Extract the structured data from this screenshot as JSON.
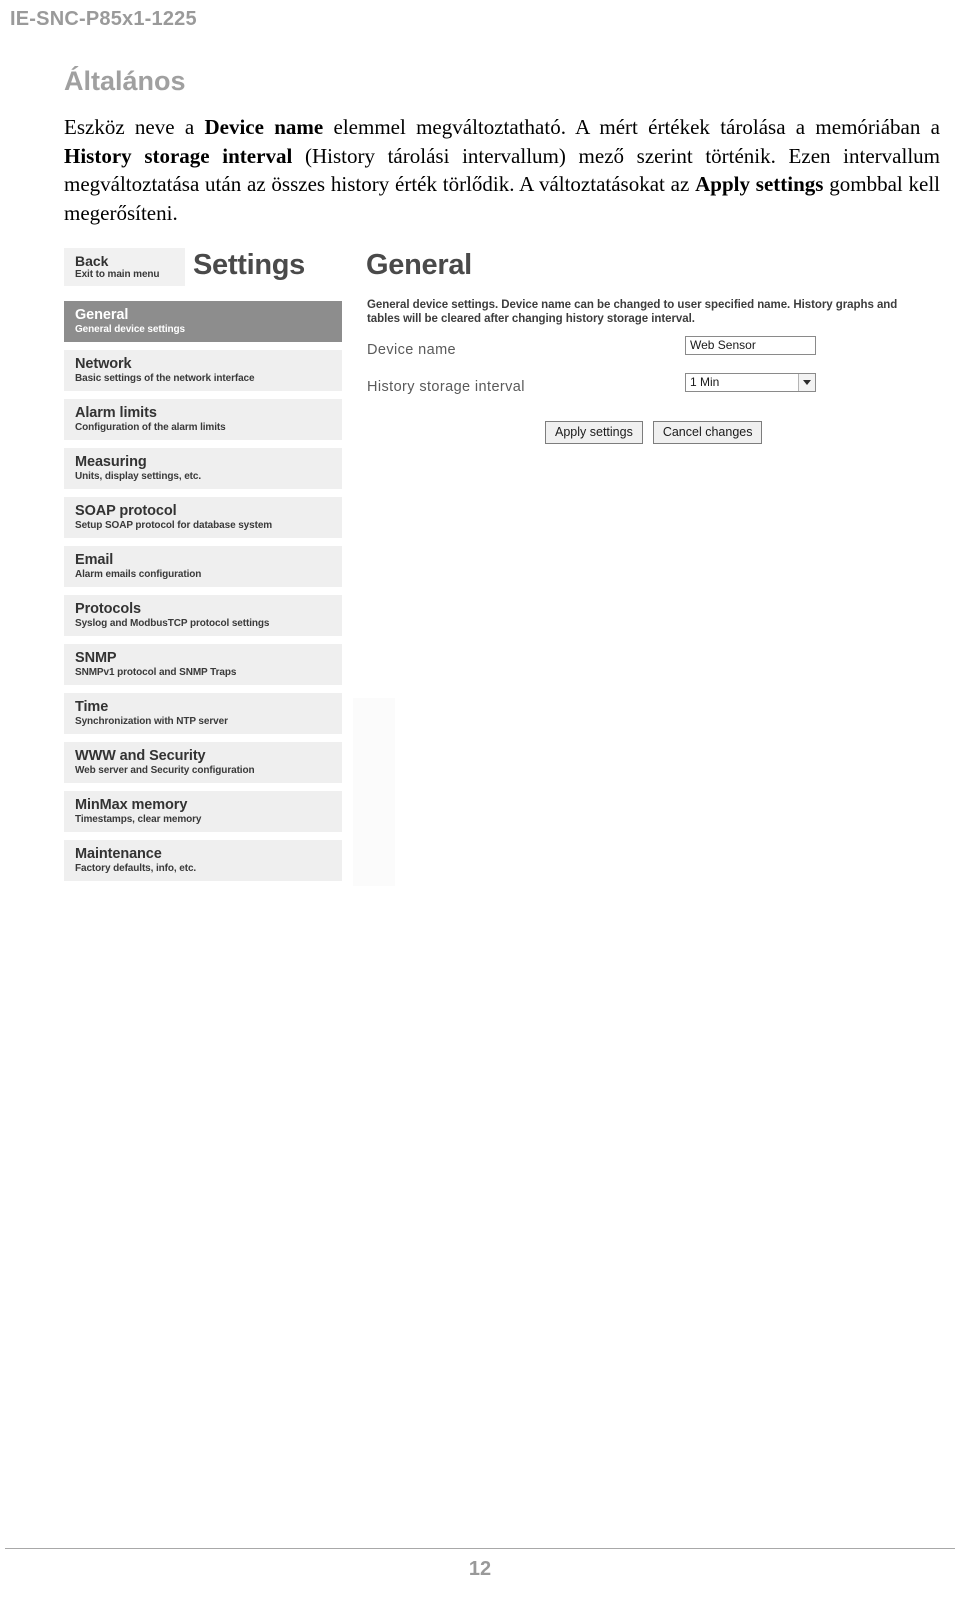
{
  "document": {
    "code": "IE-SNC-P85x1-1225",
    "section_title": "Általános",
    "page_number": "12",
    "paragraph_html": "Eszköz neve a <b>Device name</b> elemmel megváltoztatható. A mért értékek tárolása a memóriában a <b>History storage interval</b> (History tárolási intervallum) mező szerint történik. Ezen intervallum megváltoztatása után az összes history érték törlődik. A változtatásokat az <b>Apply settings</b> gombbal kell megerősíteni."
  },
  "screenshot": {
    "back_button": {
      "title": "Back",
      "subtitle": "Exit to main menu"
    },
    "title_settings": "Settings",
    "title_page": "General",
    "description": "General device settings. Device name can be changed to user specified name. History graphs and tables will be cleared after changing history storage interval.",
    "menu": [
      {
        "title": "General",
        "subtitle": "General device settings",
        "active": true
      },
      {
        "title": "Network",
        "subtitle": "Basic settings of the network interface",
        "active": false
      },
      {
        "title": "Alarm limits",
        "subtitle": "Configuration of the alarm limits",
        "active": false
      },
      {
        "title": "Measuring",
        "subtitle": "Units, display settings, etc.",
        "active": false
      },
      {
        "title": "SOAP protocol",
        "subtitle": "Setup SOAP protocol for database system",
        "active": false
      },
      {
        "title": "Email",
        "subtitle": "Alarm emails configuration",
        "active": false
      },
      {
        "title": "Protocols",
        "subtitle": "Syslog and ModbusTCP protocol settings",
        "active": false
      },
      {
        "title": "SNMP",
        "subtitle": "SNMPv1 protocol and SNMP Traps",
        "active": false
      },
      {
        "title": "Time",
        "subtitle": "Synchronization with NTP server",
        "active": false
      },
      {
        "title": "WWW and Security",
        "subtitle": "Web server and Security configuration",
        "active": false
      },
      {
        "title": "MinMax memory",
        "subtitle": "Timestamps, clear memory",
        "active": false
      },
      {
        "title": "Maintenance",
        "subtitle": "Factory defaults, info, etc.",
        "active": false
      }
    ],
    "form": {
      "device_name": {
        "label": "Device name",
        "value": "Web Sensor"
      },
      "history_storage_interval": {
        "label": "History storage interval",
        "value": "1 Min"
      },
      "apply_button": "Apply settings",
      "cancel_button": "Cancel changes"
    },
    "colors": {
      "menu_active_bg": "#8d8d8d",
      "menu_bg": "#efefef",
      "heading": "#4a4a4a"
    }
  }
}
